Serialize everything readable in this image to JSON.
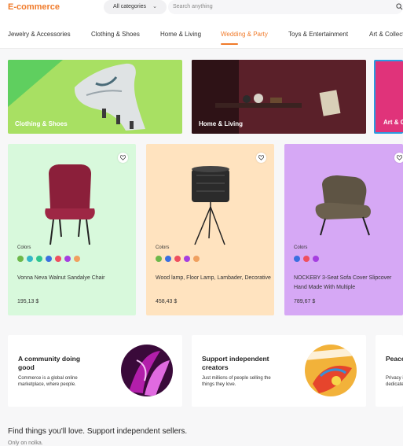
{
  "header": {
    "logo": "E-commerce",
    "category_select": "All categories",
    "search_placeholder": "Search anything"
  },
  "nav": {
    "items": [
      {
        "label": "Jewelry & Accessories"
      },
      {
        "label": "Clothing & Shoes"
      },
      {
        "label": "Home & Living"
      },
      {
        "label": "Wedding & Party"
      },
      {
        "label": "Toys & Entertainment"
      },
      {
        "label": "Art & Collectibles"
      }
    ],
    "active": "Wedding & Party"
  },
  "tiles": [
    {
      "label": "Clothing & Shoes",
      "color": "#a8e063"
    },
    {
      "label": "Home & Living",
      "color": "#4a1e25"
    },
    {
      "label": "Art & Collectibles",
      "color": "#e0337a"
    }
  ],
  "products": [
    {
      "colors_label": "Colors",
      "swatches": [
        "#6db84a",
        "#35b6c7",
        "#2ec68f",
        "#3b6fe0",
        "#ef4f5f",
        "#a63fe0",
        "#f0a05f"
      ],
      "name": "Vonna Neva Walnut Sandalye Chair",
      "price": "195,13 $",
      "bg": "#d8f9dc"
    },
    {
      "colors_label": "Colors",
      "swatches": [
        "#6db84a",
        "#3b6fe0",
        "#ef4f5f",
        "#a63fe0",
        "#f0a05f"
      ],
      "name": "Wood lamp, Floor Lamp, Lambader, Decorative",
      "price": "458,43 $",
      "bg": "#ffe3bf"
    },
    {
      "colors_label": "Colors",
      "swatches": [
        "#3b6fe0",
        "#ef4f5f",
        "#a63fe0"
      ],
      "name": "NOCKEBY 3-Seat Sofa Cover Slipcover Hand Made With Multiple",
      "price": "789,67 $",
      "bg": "#d6a8f5"
    }
  ],
  "promos": [
    {
      "title": "A community doing good",
      "desc": "Commerce is a global online marketplace, where people."
    },
    {
      "title": "Support independent creators",
      "desc": "Just millions of people selling the things they love."
    },
    {
      "title": "Peace of mind",
      "desc": "Privacy is the highest priority of our dedicated team."
    }
  ],
  "footer": {
    "title": "Find things you'll love. Support independent sellers.",
    "subtitle": "Only on nolka."
  },
  "accent": "#f07b2b"
}
